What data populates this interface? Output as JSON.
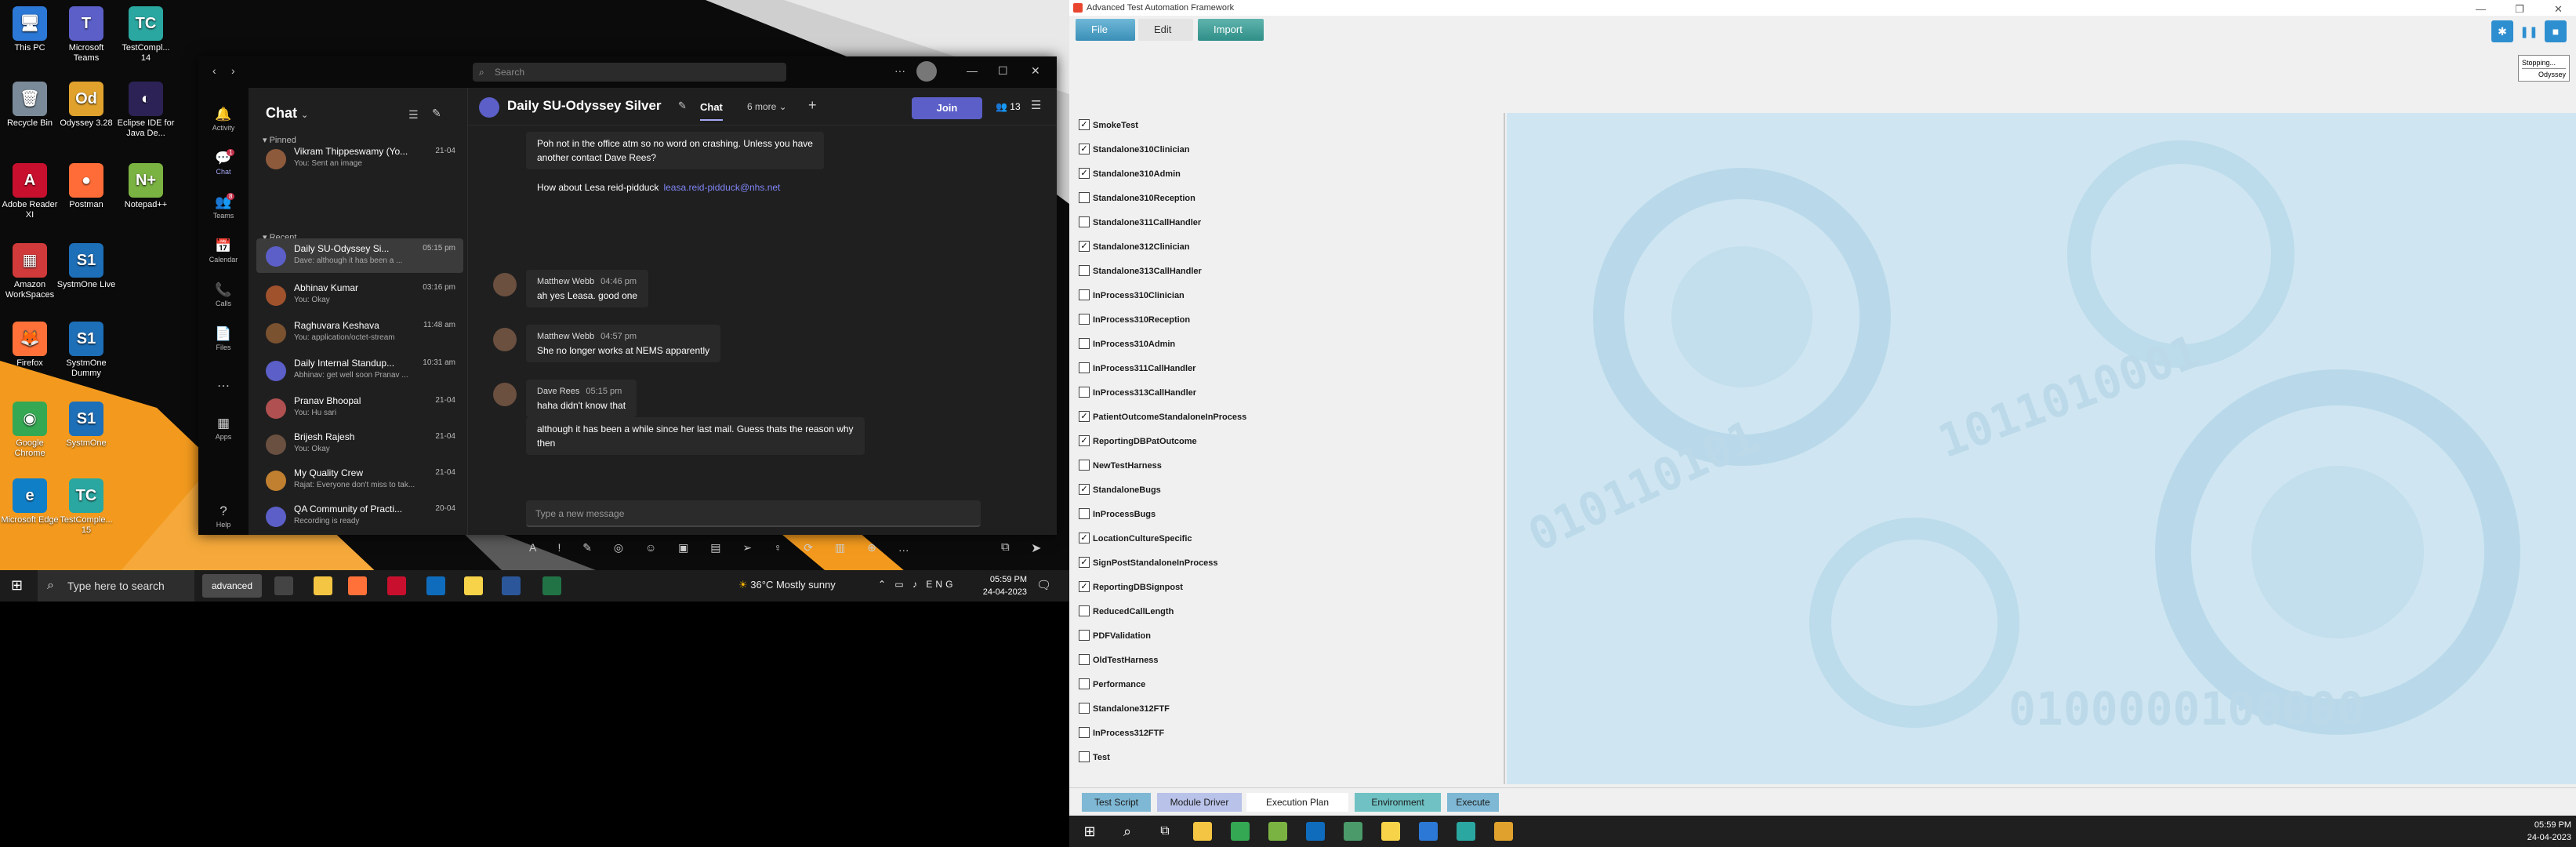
{
  "desktop": {
    "icons": [
      {
        "label": "This PC",
        "glyph": "🖥",
        "color": "#2b78d6"
      },
      {
        "label": "Microsoft Teams",
        "glyph": "T",
        "color": "#5b5fc7"
      },
      {
        "label": "TestCompl... 14",
        "glyph": "TC",
        "color": "#2aa7a0"
      },
      {
        "label": "Recycle Bin",
        "glyph": "🗑",
        "color": "#7a8a99"
      },
      {
        "label": "Odyssey 3.28",
        "glyph": "Od",
        "color": "#e0a22d"
      },
      {
        "label": "Eclipse IDE for Java De...",
        "glyph": "◐",
        "color": "#2c2255"
      },
      {
        "label": "Adobe Reader XI",
        "glyph": "A",
        "color": "#c8102e"
      },
      {
        "label": "Postman",
        "glyph": "●",
        "color": "#ff6c37"
      },
      {
        "label": "Notepad++",
        "glyph": "N+",
        "color": "#7bb342"
      },
      {
        "label": "Amazon WorkSpaces",
        "glyph": "▦",
        "color": "#d13a3a"
      },
      {
        "label": "SystmOne Live",
        "glyph": "S1",
        "color": "#1d6fb8"
      },
      {
        "label": "Firefox",
        "glyph": "🦊",
        "color": "#ff7139"
      },
      {
        "label": "SystmOne Dummy",
        "glyph": "S1",
        "color": "#1d6fb8"
      },
      {
        "label": "Google Chrome",
        "glyph": "◉",
        "color": "#34a853"
      },
      {
        "label": "SystmOne",
        "glyph": "S1",
        "color": "#1d6fb8"
      },
      {
        "label": "Microsoft Edge",
        "glyph": "e",
        "color": "#0f7fc8"
      },
      {
        "label": "TestComple... 15",
        "glyph": "TC",
        "color": "#2aa7a0"
      }
    ]
  },
  "teams": {
    "search_placeholder": "Search",
    "rail": [
      {
        "label": "Activity",
        "glyph": "🔔",
        "badge": ""
      },
      {
        "label": "Chat",
        "glyph": "💬",
        "badge": "1"
      },
      {
        "label": "Teams",
        "glyph": "👥",
        "badge": "8"
      },
      {
        "label": "Calendar",
        "glyph": "📅",
        "badge": ""
      },
      {
        "label": "Calls",
        "glyph": "📞",
        "badge": ""
      },
      {
        "label": "Files",
        "glyph": "📄",
        "badge": ""
      },
      {
        "label": "...",
        "glyph": "…",
        "badge": ""
      },
      {
        "label": "Apps",
        "glyph": "▦",
        "badge": ""
      },
      {
        "label": "Help",
        "glyph": "?",
        "badge": ""
      }
    ],
    "chat_title": "Chat",
    "pinned_label": "Pinned",
    "recent_label": "Recent",
    "chats": [
      {
        "name": "Vikram Thippeswamy (Yo...",
        "preview": "You: Sent an image",
        "time": "21-04",
        "color": "#8e5a3c",
        "active": false,
        "section": "pinned"
      },
      {
        "name": "Daily SU-Odyssey Si...",
        "preview": "Dave: although it has been a ...",
        "time": "05:15 pm",
        "color": "#5b5fc7",
        "active": true,
        "section": "recent"
      },
      {
        "name": "Abhinav Kumar",
        "preview": "You: Okay",
        "time": "03:16 pm",
        "color": "#a0522d",
        "active": false,
        "section": "recent"
      },
      {
        "name": "Raghuvara Keshava",
        "preview": "You: application/octet-stream",
        "time": "11:48 am",
        "color": "#7a5230",
        "active": false,
        "section": "recent"
      },
      {
        "name": "Daily Internal Standup...",
        "preview": "Abhinav: get well soon Pranav ...",
        "time": "10:31 am",
        "color": "#5b5fc7",
        "active": false,
        "section": "recent"
      },
      {
        "name": "Pranav Bhoopal",
        "preview": "You: Hu sari",
        "time": "21-04",
        "color": "#b05050",
        "active": false,
        "section": "recent"
      },
      {
        "name": "Brijesh Rajesh",
        "preview": "You: Okay",
        "time": "21-04",
        "color": "#6a5040",
        "active": false,
        "section": "recent"
      },
      {
        "name": "My Quality Crew",
        "preview": "Rajat: Everyone don't miss to tak...",
        "time": "21-04",
        "color": "#c08030",
        "active": false,
        "section": "recent"
      },
      {
        "name": "QA Community of Practi...",
        "preview": "Recording is ready",
        "time": "20-04",
        "color": "#5b5fc7",
        "active": false,
        "section": "recent"
      }
    ],
    "header": {
      "title": "Daily SU-Odyssey Silver",
      "tab_chat": "Chat",
      "tab_more": "6 more ⌄",
      "join": "Join",
      "participants": "13"
    },
    "messages": [
      {
        "who": "",
        "time": "",
        "lines": [
          "Poh not in the office atm so no word on crashing. Unless you have",
          "another contact Dave Rees?"
        ],
        "link": ""
      },
      {
        "who": "",
        "time": "",
        "lines": [
          "How about Lesa reid-pidduck"
        ],
        "link": "leasa.reid-pidduck@nhs.net"
      },
      {
        "who": "Matthew Webb",
        "time": "04:46 pm",
        "lines": [
          "ah yes Leasa. good one"
        ],
        "link": ""
      },
      {
        "who": "Matthew Webb",
        "time": "04:57 pm",
        "lines": [
          "She no longer works at NEMS apparently"
        ],
        "link": ""
      },
      {
        "who": "Dave Rees",
        "time": "05:15 pm",
        "lines": [
          "haha didn't know that"
        ],
        "link": ""
      },
      {
        "who": "",
        "time": "",
        "lines": [
          "although it has been a while since her last mail. Guess thats the reason why",
          "then"
        ],
        "link": ""
      }
    ],
    "compose_placeholder": "Type a new message",
    "compose_tools": "A ! ✎ ◎ ☺ ▣ ▤ ➢ ♀ ⟳ ▥ ⊕ …"
  },
  "taskbar_left": {
    "search_placeholder": "Type here to search",
    "advanced_label": "advanced",
    "weather": "36°C  Mostly sunny",
    "tray": "⌃ ▭ ♪ ENG",
    "time": "05:59 PM",
    "date": "24-04-2023",
    "apps": [
      {
        "name": "task-view",
        "color": "#444"
      },
      {
        "name": "file-explorer",
        "color": "#f4c542"
      },
      {
        "name": "firefox",
        "color": "#ff7139"
      },
      {
        "name": "odyssey",
        "color": "#c8102e"
      },
      {
        "name": "outlook",
        "color": "#0f6cbd"
      },
      {
        "name": "sticky",
        "color": "#f7d34a"
      },
      {
        "name": "word",
        "color": "#2b579a"
      },
      {
        "name": "excel",
        "color": "#217346"
      }
    ]
  },
  "atf": {
    "title": "Advanced Test Automation Framework",
    "menu": {
      "file": "File",
      "edit": "Edit",
      "import": "Import"
    },
    "status_line1": "Stopping...",
    "status_line2": "Odyssey",
    "tests": [
      {
        "label": "SmokeTest",
        "checked": true
      },
      {
        "label": "Standalone310Clinician",
        "checked": true
      },
      {
        "label": "Standalone310Admin",
        "checked": true
      },
      {
        "label": "Standalone310Reception",
        "checked": false
      },
      {
        "label": "Standalone311CallHandler",
        "checked": false
      },
      {
        "label": "Standalone312Clinician",
        "checked": true
      },
      {
        "label": "Standalone313CallHandler",
        "checked": false
      },
      {
        "label": "InProcess310Clinician",
        "checked": false
      },
      {
        "label": "InProcess310Reception",
        "checked": false
      },
      {
        "label": "InProcess310Admin",
        "checked": false
      },
      {
        "label": "InProcess311CallHandler",
        "checked": false
      },
      {
        "label": "InProcess313CallHandler",
        "checked": false
      },
      {
        "label": "PatientOutcomeStandaloneInProcess",
        "checked": true
      },
      {
        "label": "ReportingDBPatOutcome",
        "checked": true
      },
      {
        "label": "NewTestHarness",
        "checked": false
      },
      {
        "label": "StandaloneBugs",
        "checked": true
      },
      {
        "label": "InProcessBugs",
        "checked": false
      },
      {
        "label": "LocationCultureSpecific",
        "checked": true
      },
      {
        "label": "SignPostStandaloneInProcess",
        "checked": true
      },
      {
        "label": "ReportingDBSignpost",
        "checked": true
      },
      {
        "label": "ReducedCallLength",
        "checked": false
      },
      {
        "label": "PDFValidation",
        "checked": false
      },
      {
        "label": "OldTestHarness",
        "checked": false
      },
      {
        "label": "Performance",
        "checked": false
      },
      {
        "label": "Standalone312FTF",
        "checked": false
      },
      {
        "label": "InProcess312FTF",
        "checked": false
      },
      {
        "label": "Test",
        "checked": false
      }
    ],
    "bottom_tabs": [
      {
        "label": "Test Script",
        "bg": "#7fb8d4"
      },
      {
        "label": "Module Driver",
        "bg": "#b9c2e8"
      },
      {
        "label": "Execution Plan",
        "bg": "#ffffff"
      },
      {
        "label": "Environment",
        "bg": "#6fc1c3"
      },
      {
        "label": "Execute",
        "bg": "#7fb8d4"
      }
    ]
  },
  "taskbar_right": {
    "time": "05:59 PM",
    "date": "24-04-2023",
    "apps": [
      {
        "name": "start",
        "color": "#1f1f1f"
      },
      {
        "name": "search",
        "color": "#1f1f1f"
      },
      {
        "name": "task-view",
        "color": "#1f1f1f"
      },
      {
        "name": "file-explorer",
        "color": "#f4c542"
      },
      {
        "name": "chrome",
        "color": "#34a853"
      },
      {
        "name": "notepad-plus",
        "color": "#7bb342"
      },
      {
        "name": "outlook",
        "color": "#0f6cbd"
      },
      {
        "name": "app-green",
        "color": "#4a9a6a"
      },
      {
        "name": "sticky",
        "color": "#f7d34a"
      },
      {
        "name": "app-blue",
        "color": "#2b78d6"
      },
      {
        "name": "testcomplete",
        "color": "#2aa7a0"
      },
      {
        "name": "odyssey",
        "color": "#e0a22d"
      }
    ]
  }
}
